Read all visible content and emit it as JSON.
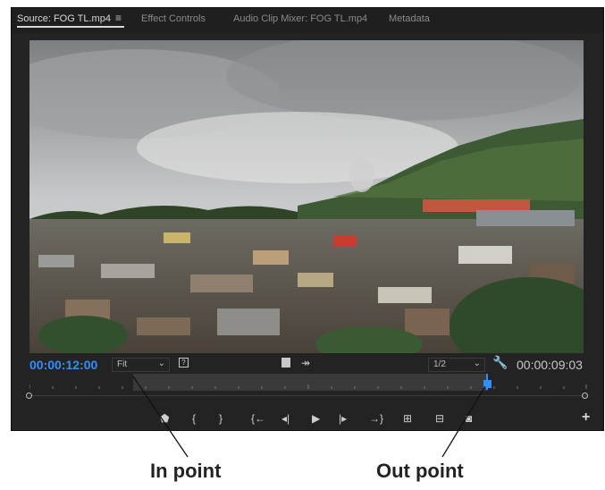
{
  "tabs": {
    "source": "Source: FOG TL.mp4",
    "effect_controls": "Effect Controls",
    "audio_mixer": "Audio Clip Mixer: FOG TL.mp4",
    "metadata": "Metadata",
    "menu_icon": "hamburger-menu-icon"
  },
  "controls": {
    "timecode_in": "00:00:12:00",
    "timecode_duration": "00:00:09:03",
    "zoom_value": "Fit",
    "resolution_value": "1/2"
  },
  "transport": {
    "icons": [
      "add-marker-icon",
      "mark-in-icon",
      "mark-out-icon",
      "go-to-in-icon",
      "step-back-icon",
      "play-icon",
      "step-forward-icon",
      "go-to-out-icon",
      "insert-icon",
      "overwrite-icon",
      "export-frame-icon",
      "button-editor-plus-icon"
    ]
  },
  "callouts": {
    "in_point": "In point",
    "out_point": "Out point"
  },
  "colors": {
    "timecode_blue": "#2f8fff",
    "panel_bg": "#232323"
  }
}
